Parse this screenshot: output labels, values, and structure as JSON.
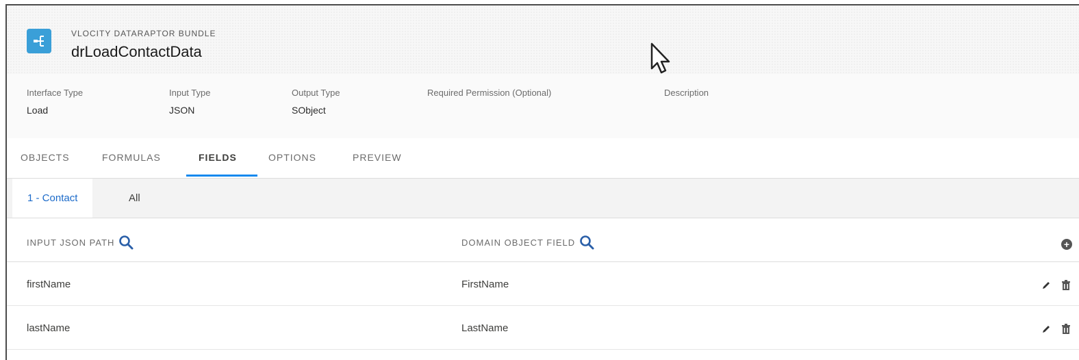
{
  "header": {
    "eyebrow": "VLOCITY DATARAPTOR BUNDLE",
    "title": "drLoadContactData"
  },
  "details": [
    {
      "label": "Interface Type",
      "value": "Load"
    },
    {
      "label": "Input Type",
      "value": "JSON"
    },
    {
      "label": "Output Type",
      "value": "SObject"
    },
    {
      "label": "Required Permission (Optional)",
      "value": ""
    },
    {
      "label": "Description",
      "value": ""
    }
  ],
  "tabs": [
    {
      "label": "OBJECTS"
    },
    {
      "label": "FORMULAS"
    },
    {
      "label": "FIELDS",
      "active": true
    },
    {
      "label": "OPTIONS"
    },
    {
      "label": "PREVIEW"
    }
  ],
  "subtabs": [
    {
      "label": "1 - Contact",
      "active": true
    },
    {
      "label": "All"
    }
  ],
  "table": {
    "columns": [
      "INPUT JSON PATH",
      "DOMAIN OBJECT FIELD"
    ],
    "rows": [
      {
        "input": "firstName",
        "field": "FirstName"
      },
      {
        "input": "lastName",
        "field": "LastName"
      }
    ]
  },
  "icons": {
    "app": "dataraptor-icon",
    "search": "search-icon",
    "add": "add-icon",
    "edit": "pencil-icon",
    "delete": "trash-icon"
  },
  "colors": {
    "accent": "#1589ee",
    "app_icon": "#3a9fd8",
    "active_subtab": "#1b6ac9"
  }
}
